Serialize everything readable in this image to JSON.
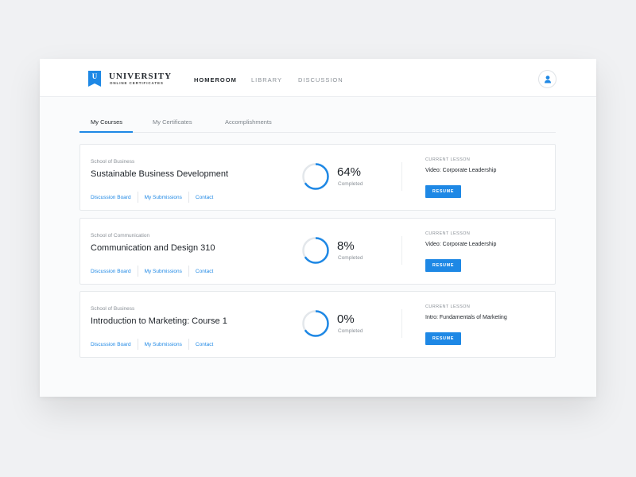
{
  "brand": {
    "badge_letter": "U",
    "title": "UNIVERSITY",
    "subtitle": "ONLINE CERTIFICATES",
    "accent_color": "#1e88e5"
  },
  "nav": {
    "items": [
      {
        "label": "HOMEROOM",
        "active": true
      },
      {
        "label": "LIBRARY",
        "active": false
      },
      {
        "label": "DISCUSSION",
        "active": false
      }
    ],
    "avatar_icon": "user-icon"
  },
  "tabs": [
    {
      "label": "My Courses",
      "active": true
    },
    {
      "label": "My Certificates",
      "active": false
    },
    {
      "label": "Accomplishments",
      "active": false
    }
  ],
  "courses": [
    {
      "school": "School of Business",
      "title": "Sustainable Business Development",
      "links": [
        "Discussion Board",
        "My Submissions",
        "Contact"
      ],
      "progress_text": "64%",
      "progress_value": 0.64,
      "progress_label": "Completed",
      "current_lesson_label": "CURRENT LESSON",
      "current_lesson": "Video: Corporate Leadership",
      "action_label": "RESUME"
    },
    {
      "school": "School of Communication",
      "title": "Communication and Design 310",
      "links": [
        "Discussion Board",
        "My Submissions",
        "Contact"
      ],
      "progress_text": "8%",
      "progress_value": 0.08,
      "progress_label": "Completed",
      "current_lesson_label": "CURRENT LESSON",
      "current_lesson": "Video: Corporate Leadership",
      "action_label": "RESUME"
    },
    {
      "school": "School of Business",
      "title": "Introduction to Marketing: Course 1",
      "links": [
        "Discussion Board",
        "My Submissions",
        "Contact"
      ],
      "progress_text": "0%",
      "progress_value": 0.0,
      "progress_label": "Completed",
      "current_lesson_label": "CURRENT LESSON",
      "current_lesson": "Intro: Fundamentals of Marketing",
      "action_label": "RESUME"
    }
  ]
}
